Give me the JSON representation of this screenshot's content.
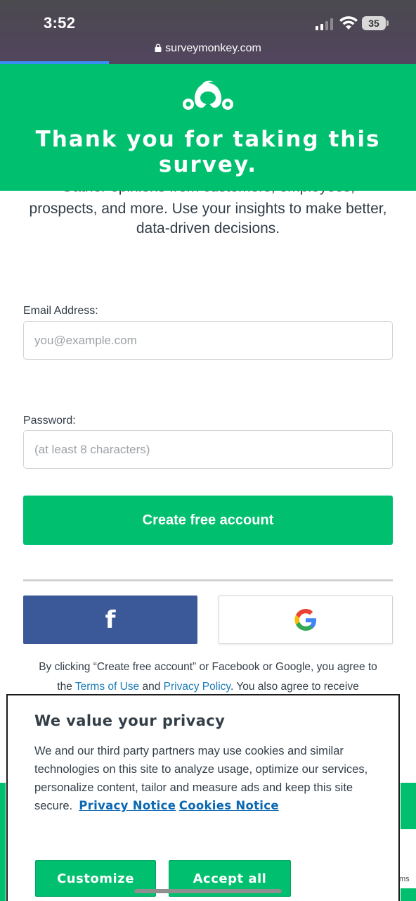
{
  "status_bar": {
    "time": "3:52",
    "battery": "35"
  },
  "browser": {
    "url": "surveymonkey.com",
    "progress_color": "#3a8ef6"
  },
  "banner": {
    "logo_icon": "surveymonkey-logo-icon",
    "title": "Thank you for taking this survey.",
    "color": "#00bf6f"
  },
  "intro": {
    "cut_line": "Gather opinions from customers, employees,",
    "text": "prospects, and more. Use your insights to make better, data-driven decisions."
  },
  "form": {
    "email_label": "Email Address:",
    "email_placeholder": "you@example.com",
    "password_label": "Password:",
    "password_placeholder": "(at least 8 characters)",
    "create_button": "Create free account",
    "facebook_icon": "f",
    "google_icon": "google-icon"
  },
  "legal": {
    "line1": "By clicking “Create free account” or Facebook or Google, you agree to",
    "prefix": "the ",
    "terms_link": "Terms of Use",
    "and": " and ",
    "privacy_link": "Privacy Policy",
    "suffix": ". You also agree to receive"
  },
  "underlay": {
    "side_text": "ms"
  },
  "privacy_modal": {
    "title": "We value your privacy",
    "body": "We and our third party partners may use cookies and similar technologies on this site to analyze usage, optimize our services, personalize content, tailor and measure ads and keep this site secure.",
    "privacy_notice_link": "Privacy Notice",
    "cookies_notice_link": "Cookies Notice",
    "customize_button": "Customize",
    "accept_button": "Accept all"
  }
}
